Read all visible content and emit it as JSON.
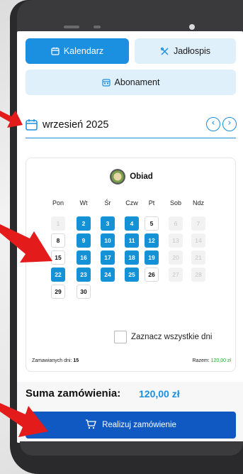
{
  "tabs": {
    "calendar": "Kalendarz",
    "menu": "Jadłospis",
    "subscription": "Abonament"
  },
  "month": {
    "label": "wrzesień 2025",
    "prev_icon": "chevron-left-icon",
    "next_icon": "chevron-right-icon"
  },
  "meal": {
    "name": "Obiad",
    "icon": "meal-plate-icon"
  },
  "weekdays": [
    "Pon",
    "Wt",
    "Śr",
    "Czw",
    "Pt",
    "Sob",
    "Ndz"
  ],
  "days": [
    {
      "n": "1",
      "state": "disabled"
    },
    {
      "n": "2",
      "state": "ordered"
    },
    {
      "n": "3",
      "state": "ordered"
    },
    {
      "n": "4",
      "state": "ordered"
    },
    {
      "n": "5",
      "state": "available"
    },
    {
      "n": "6",
      "state": "disabled"
    },
    {
      "n": "7",
      "state": "disabled"
    },
    {
      "n": "8",
      "state": "available"
    },
    {
      "n": "9",
      "state": "ordered"
    },
    {
      "n": "10",
      "state": "ordered"
    },
    {
      "n": "11",
      "state": "ordered"
    },
    {
      "n": "12",
      "state": "ordered"
    },
    {
      "n": "13",
      "state": "disabled"
    },
    {
      "n": "14",
      "state": "disabled"
    },
    {
      "n": "15",
      "state": "available"
    },
    {
      "n": "16",
      "state": "ordered"
    },
    {
      "n": "17",
      "state": "ordered"
    },
    {
      "n": "18",
      "state": "ordered"
    },
    {
      "n": "19",
      "state": "ordered"
    },
    {
      "n": "20",
      "state": "disabled"
    },
    {
      "n": "21",
      "state": "disabled"
    },
    {
      "n": "22",
      "state": "ordered"
    },
    {
      "n": "23",
      "state": "ordered"
    },
    {
      "n": "24",
      "state": "ordered"
    },
    {
      "n": "25",
      "state": "ordered"
    },
    {
      "n": "26",
      "state": "available"
    },
    {
      "n": "27",
      "state": "disabled"
    },
    {
      "n": "28",
      "state": "disabled"
    },
    {
      "n": "29",
      "state": "available"
    },
    {
      "n": "30",
      "state": "available"
    }
  ],
  "select_all": {
    "label": "Zaznacz wszystkie dni",
    "checked": false
  },
  "summary": {
    "ordered_days_label": "Zamawianych dni:",
    "ordered_days_value": "15",
    "total_label": "Razem:",
    "total_value": "120,00 zł"
  },
  "footer": {
    "sum_label": "Suma zamówienia:",
    "sum_value": "120,00 zł",
    "order_button": "Realizuj zamówienie",
    "cart_icon": "cart-icon"
  },
  "colors": {
    "primary": "#1b8fe0",
    "ordered_day": "#1591d6",
    "order_button": "#1159c2",
    "light_tab": "#dff0fb",
    "total_green": "#1faa2e",
    "annotation_arrow": "#e31b1b"
  }
}
